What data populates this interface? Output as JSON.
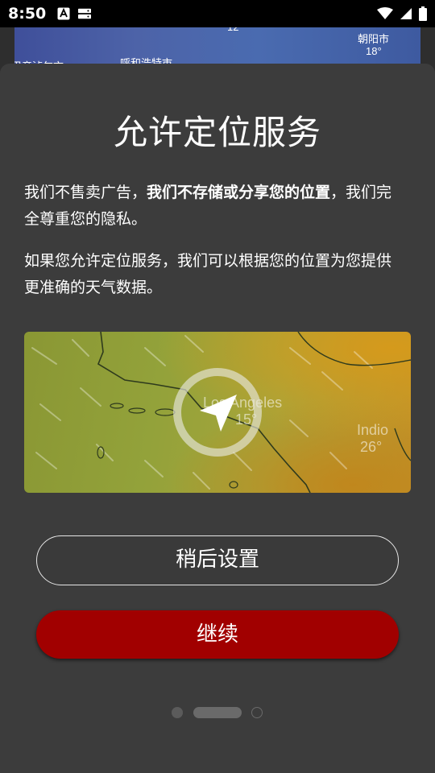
{
  "status_bar": {
    "time": "8:50",
    "icons": [
      "a-notification-icon",
      "storage-notification-icon",
      "wifi-icon",
      "signal-icon",
      "battery-icon"
    ]
  },
  "background_map": {
    "labels": [
      "12",
      "朝阳市",
      "18°",
      "呼和浩特市",
      "巴彦淖尔市"
    ]
  },
  "dialog": {
    "title": "允许定位服务",
    "para1_before": "我们不售卖广告，",
    "para1_bold": "我们不存储或分享您的位置",
    "para1_after": "，我们完全尊重您的隐私。",
    "para2": "如果您允许定位服务，我们可以根据您的位置为您提供更准确的天气数据。",
    "map": {
      "city1_name": "Los Angeles",
      "city1_temp": "15°",
      "city2_name": "Indio",
      "city2_temp": "26°",
      "icon": "location-arrow-icon"
    },
    "later_label": "稍后设置",
    "continue_label": "继续",
    "pager": {
      "count": 3,
      "active_index": 1
    }
  },
  "colors": {
    "sheet_bg": "#3c3c3c",
    "continue_bg": "#a10000",
    "text": "#ffffff"
  }
}
